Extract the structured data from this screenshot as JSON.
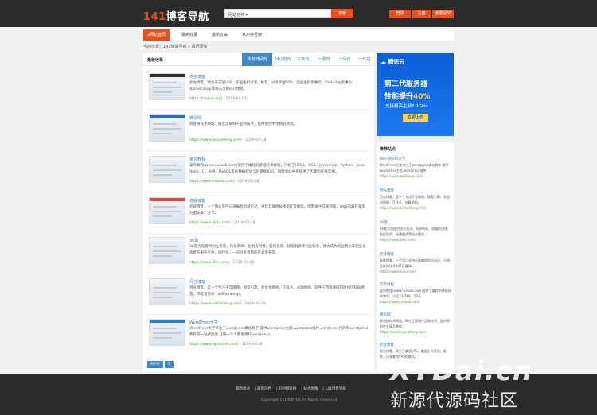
{
  "header": {
    "logo_num": "141",
    "logo_text": "博客导航",
    "search_value": "网站名称 ▾",
    "search_button": "搜索",
    "login": "登录",
    "register": "注册",
    "submit": "我要提交"
  },
  "nav": {
    "items": [
      "⌂网站首页",
      "最新收录",
      "最新文章",
      "TOP排行榜"
    ]
  },
  "breadcrumb": "当前位置：141博客导航 » 最近更新",
  "main": {
    "title": "最新收录",
    "tabs": [
      "所有时间内",
      "24小时内",
      "三天内",
      "一周内",
      "一月内",
      "一年内"
    ],
    "items": [
      {
        "title": "老左博客",
        "desc": "老左博客，致力于美国VPS、美国主机评测，推荐，分享美国VPS、美国主机优惠码、Godaddy优惠码、NameCheap等域名优惠码IT博客。",
        "url": "https://laozuo.org/",
        "date": "- 2019-04-01"
      },
      {
        "title": "腾讯网",
        "desc": "原雪梅技术网站，研究互联网产品和技术，提供原创中文精品教程。",
        "url": "https://www.laoxuefeng.com/",
        "date": "- 2019-03-28"
      },
      {
        "title": "菜鸟教程",
        "desc": "菜鸟教程(www.runoob.com)提供了编程的基础技术教程，介绍了HTML、CSS、Javascript、Python、Java、Ruby、C、PHP、MySQL等各种编程语言的基础知识。同时本站中也提供了大量的在线实例。",
        "url": "https://www.runoob.com/",
        "date": "- 2019-03-28"
      },
      {
        "title": "老薛博客",
        "desc": "老薛博客，一个用心坚持记录编程的试论述，分享互联网技术的IT自媒体，博客关注前端领域，Web前端开发等方面记录，分享。",
        "url": "https://www.ibulu.com/",
        "date": "- 2019-03-28"
      },
      {
        "title": "36氪",
        "desc": "36氪为您提供创业资讯、科技新闻、投融资对接、股权投资、极速融资等创业服务，致力成为创业者以及创业投资者的服务平台，同行业，一同创业者新的产品发布等。",
        "url": "https://www.36kr.com/",
        "date": "- 2019-03-28"
      },
      {
        "title": "月光博客",
        "desc": "月光博客，是一个专注于互联网，搜索引擎，社会化网络，IT技术，谷歌地图，软件应用等领域的原创IT科技博客，作者是月光（williamlong）。",
        "url": "https://www.williamlong.info/",
        "date": "- 2019-03-28"
      },
      {
        "title": "WordPress大学",
        "desc": "WordPress大学专注于wordpress建站教学,提供wordpress主题,wordpress插件,wordpress代码和wordpress教程等一站式服务,让每一个人都能用好wordpress。",
        "url": "https://www.wpdaxue.com/",
        "date": "- 2019-03-28"
      }
    ],
    "pager": [
      "共7条",
      "1"
    ]
  },
  "ad": {
    "brand": "腾讯云",
    "line1": "第二代服务器",
    "line2a": "性能提升",
    "line2b": "40%",
    "line3": "支持超高主频3.2GHz",
    "button": "立即上云"
  },
  "side": {
    "title": "推荐站点",
    "items": [
      {
        "title": "WordPress大学",
        "desc": "WordPress大学专注于wordpress建站教学,提供wordpress主题,wordpress插件",
        "url": "https://www.wpdaxue.com/"
      },
      {
        "title": "月光博客",
        "desc": "月光博客，是一个专注于互联网，搜索引擎，社会化网络，IT技术，谷歌地图。",
        "url": "https://www.williamlong.info/"
      },
      {
        "title": "36氪",
        "desc": "36氪为您提供创业资讯、科技新闻、投融资对接、股权投资、极速融资等创业服务。",
        "url": "https://www.36kr.com/"
      },
      {
        "title": "老薛博客",
        "desc": "老薛博客，一个用心坚持记录编程的试论述，分享互联网技术的IT自媒体。",
        "url": "https://www.ibulu.com/"
      },
      {
        "title": "菜鸟教程",
        "desc": "菜鸟教程(www.runoob.com)提供了编程的基础技术教程，介绍了HTML、CSS。",
        "url": "https://www.runoob.com/"
      },
      {
        "title": "腾讯网",
        "desc": "原雪梅技术网站，研究互联网产品和技术，提供原创中文精品教程。",
        "url": "https://www.laoxuefeng.com/"
      },
      {
        "title": "老左博客",
        "desc": "老左博客，致力于美国VPS、美国主机评测，推荐，分享美国VPS优惠码。",
        "url": "https://laozuo.org/"
      }
    ]
  },
  "footer": {
    "links": [
      "最新收录",
      "最新归档",
      "TOP排行榜",
      "站点地图",
      "141博客导航"
    ],
    "copyright": "Copyright 141博客导航 All Rights Reserved"
  },
  "watermark": {
    "line1": "XYDai.cn",
    "line2": "新源代源码社区"
  },
  "colors": {
    "accent": "#e8511f",
    "link": "#3a7dc0",
    "url": "#4a9a3a",
    "header_bg": "#2b2b2b"
  }
}
